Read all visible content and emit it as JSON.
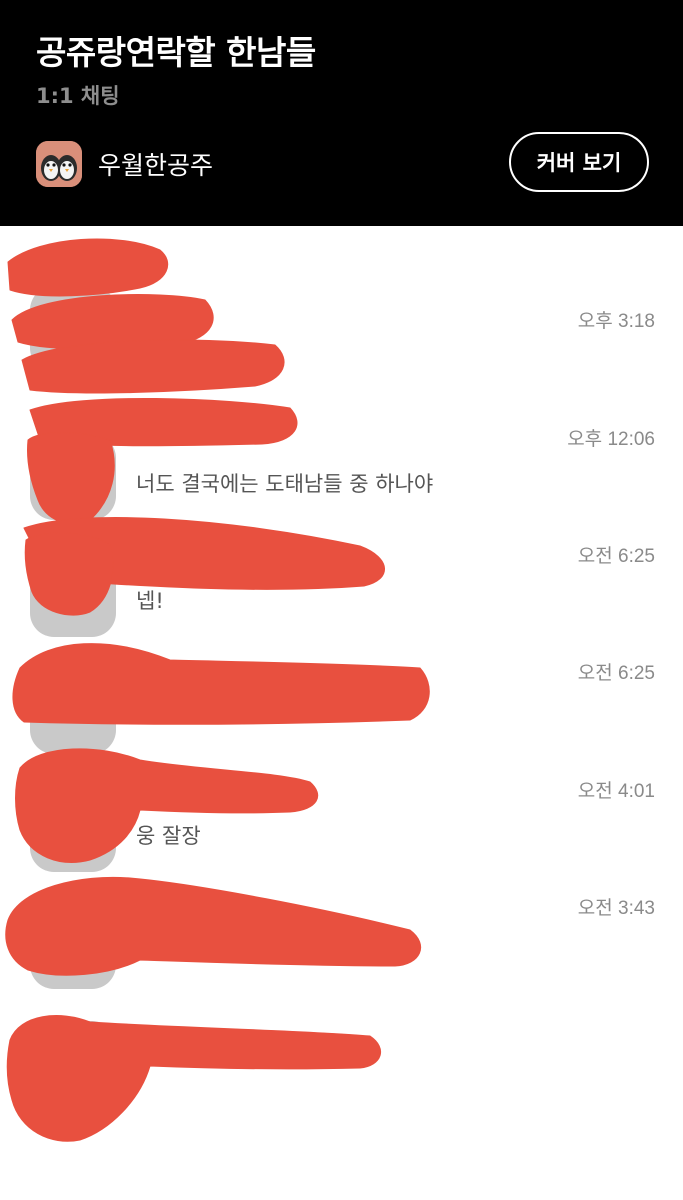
{
  "header": {
    "title": "공쥬랑연락할 한남들",
    "subtitle": "1:1 채팅",
    "host_name": "우월한공주",
    "cover_button_label": "커버 보기"
  },
  "chats": [
    {
      "time": "오후 3:18",
      "preview": ""
    },
    {
      "time": "오후 12:06",
      "preview": "너도 결국에는 도태남들 중 하나야"
    },
    {
      "time": "오전 6:25",
      "preview": "넵!"
    },
    {
      "time": "오전 6:25",
      "preview": ""
    },
    {
      "time": "오전 4:01",
      "preview": "웅 잘장"
    },
    {
      "time": "오전 3:43",
      "preview": ""
    }
  ],
  "colors": {
    "header_bg": "#000000",
    "redaction": "#e8503f",
    "time_text": "#8a8a8a"
  }
}
